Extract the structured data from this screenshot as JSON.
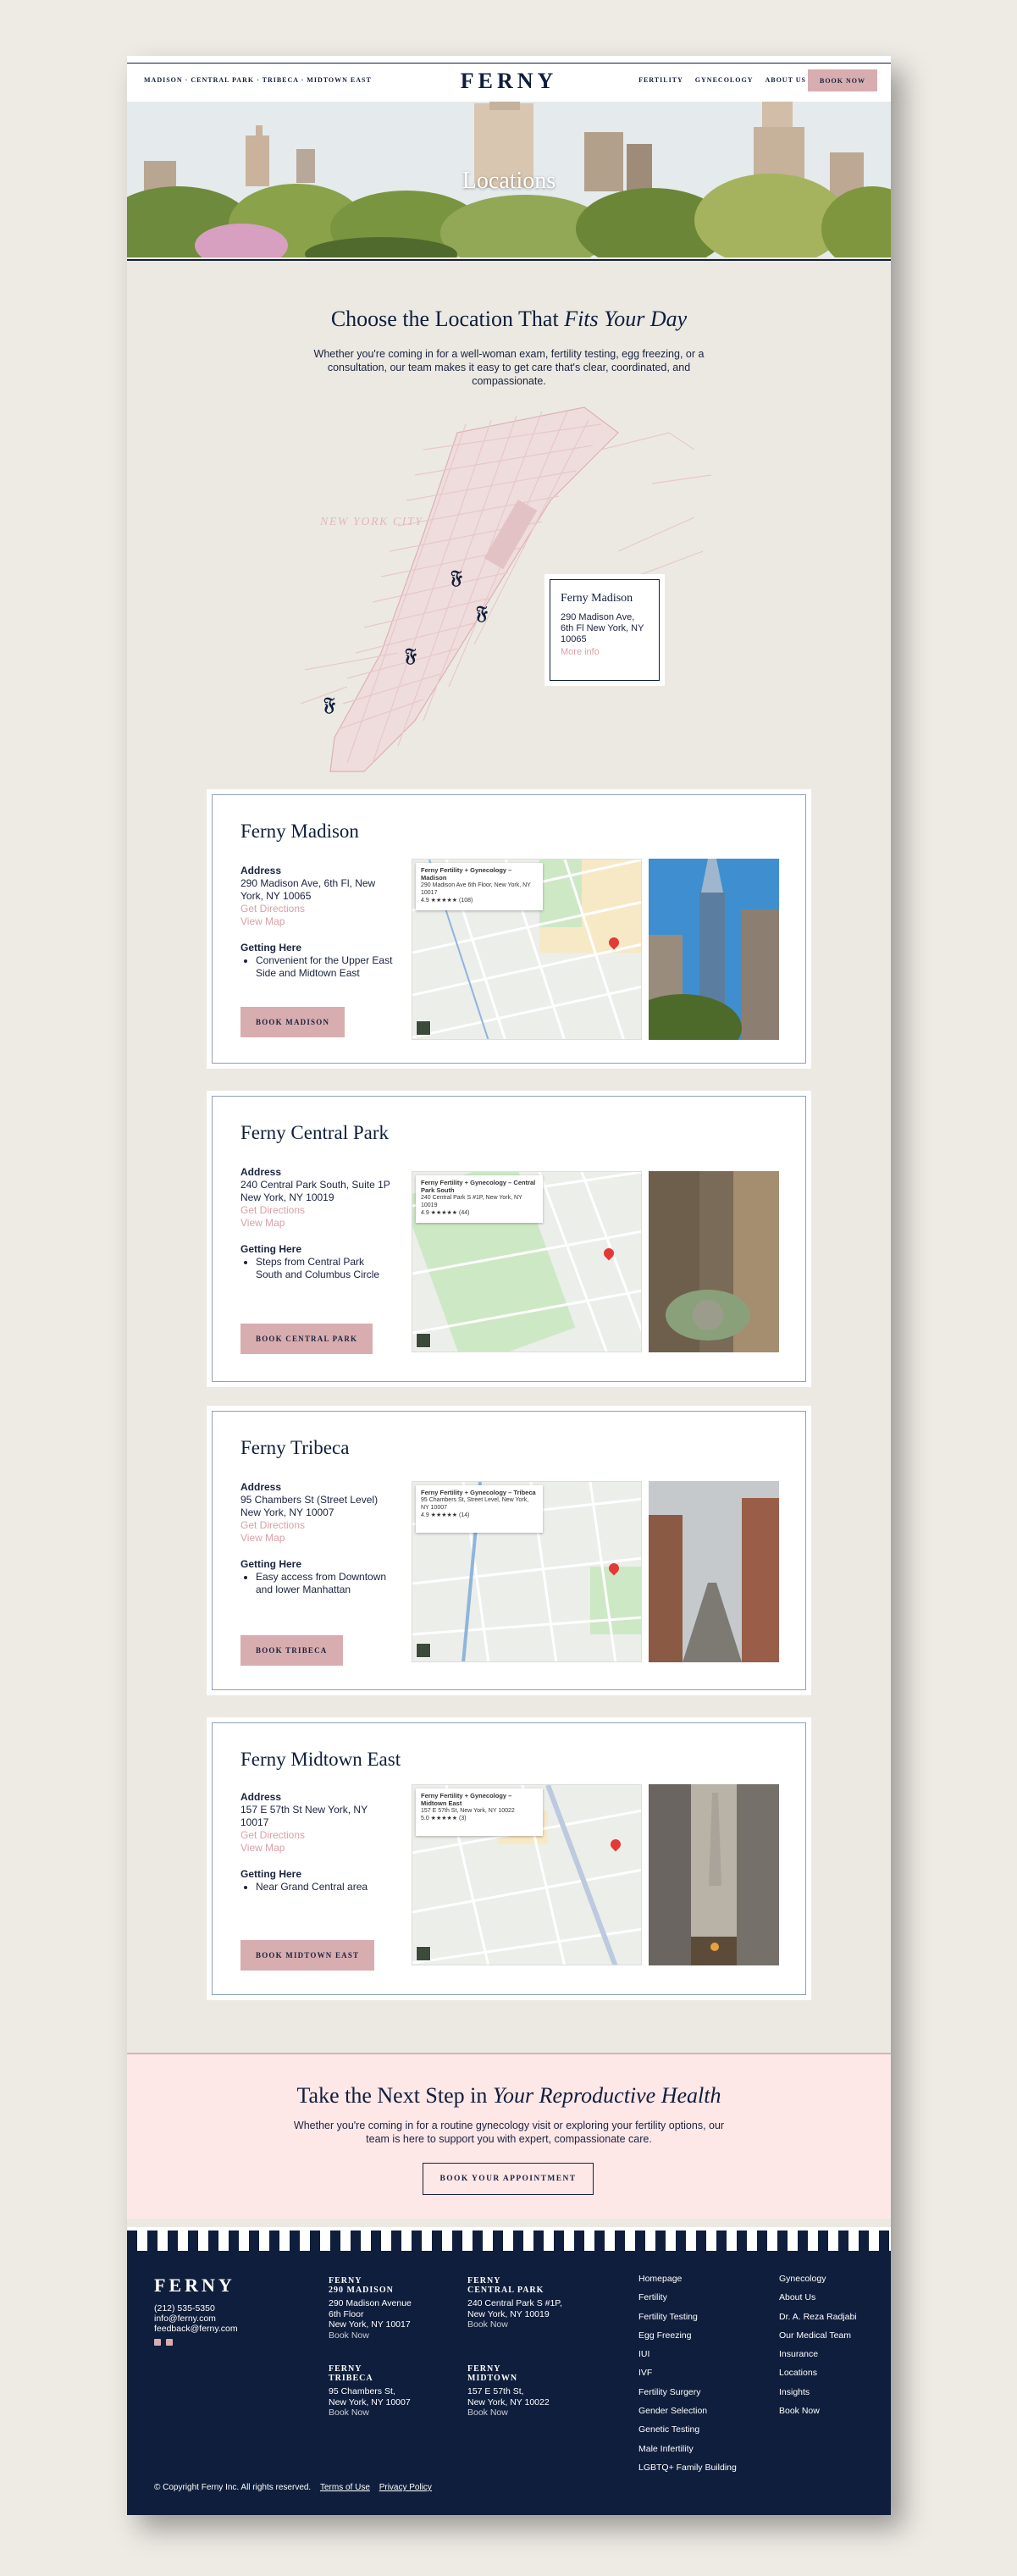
{
  "header": {
    "nav_left": "MADISON · CENTRAL PARK · TRIBECA · MIDTOWN EAST",
    "logo": "FERNY",
    "nav_right": [
      "FERTILITY",
      "GYNECOLOGY",
      "ABOUT US"
    ],
    "book_now": "BOOK NOW"
  },
  "hero": {
    "title": "Locations"
  },
  "intro": {
    "title_plain": "Choose the Location That ",
    "title_italic": "Fits Your Day",
    "text": "Whether you're coming in for a well-woman exam, fertility testing, egg freezing, or a consultation, our team makes it easy to get care that's clear, coordinated, and compassionate."
  },
  "map": {
    "city_label": "NEW YORK CITY",
    "card": {
      "name": "Ferny Madison",
      "address": "290 Madison Ave, 6th Fl New York, NY 10065",
      "more": "More info"
    }
  },
  "locations": [
    {
      "name": "Ferny Madison",
      "address_label": "Address",
      "address": "290 Madison Ave, 6th Fl, New York, NY 10065",
      "directions": "Get Directions",
      "view_map": "View Map",
      "getting_here_label": "Getting Here",
      "getting_here": "Convenient for the Upper East Side and Midtown East",
      "button": "BOOK MADISON",
      "map_popup_title": "Ferny Fertility + Gynecology – Madison",
      "map_popup_addr": "290 Madison Ave 6th Floor, New York, NY 10017",
      "map_popup_rating": "4.9 ★★★★★ (108)"
    },
    {
      "name": "Ferny Central Park",
      "address_label": "Address",
      "address": "240 Central Park South, Suite 1P New York, NY 10019",
      "directions": "Get Directions",
      "view_map": "View Map",
      "getting_here_label": "Getting Here",
      "getting_here": "Steps from Central Park South and Columbus Circle",
      "button": "BOOK CENTRAL PARK",
      "map_popup_title": "Ferny Fertility + Gynecology – Central Park South",
      "map_popup_addr": "240 Central Park S #1P, New York, NY 10019",
      "map_popup_rating": "4.9 ★★★★★ (44)"
    },
    {
      "name": "Ferny Tribeca",
      "address_label": "Address",
      "address": "95 Chambers St (Street Level) New York, NY 10007",
      "directions": "Get Directions",
      "view_map": "View Map",
      "getting_here_label": "Getting Here",
      "getting_here": "Easy access from Downtown and lower Manhattan",
      "button": "BOOK TRIBECA",
      "map_popup_title": "Ferny Fertility + Gynecology – Tribeca",
      "map_popup_addr": "95 Chambers St, Street Level, New York, NY 10007",
      "map_popup_rating": "4.9 ★★★★★ (14)"
    },
    {
      "name": "Ferny Midtown East",
      "address_label": "Address",
      "address": "157 E 57th St New York, NY 10017",
      "directions": "Get Directions",
      "view_map": "View Map",
      "getting_here_label": "Getting Here",
      "getting_here": "Near Grand Central area",
      "button": "BOOK MIDTOWN EAST",
      "map_popup_title": "Ferny Fertility + Gynecology – Midtown East",
      "map_popup_addr": "157 E 57th St, New York, NY 10022",
      "map_popup_rating": "5.0 ★★★★★ (3)"
    }
  ],
  "cta": {
    "title_plain": "Take the Next Step in ",
    "title_italic": "Your Reproductive Health",
    "text": "Whether you're coming in for a routine gynecology visit or exploring your fertility options, our team is here to support you with expert, compassionate care.",
    "button": "BOOK YOUR APPOINTMENT"
  },
  "footer": {
    "logo": "FERNY",
    "phone": "(212) 535-5350",
    "email1": "info@ferny.com",
    "email2": "feedback@ferny.com",
    "loc_madison": {
      "h1": "FERNY",
      "h2": "290 MADISON",
      "l1": "290 Madison Avenue",
      "l2": "6th Floor",
      "l3": "New York, NY 10017",
      "book": "Book Now"
    },
    "loc_central": {
      "h1": "FERNY",
      "h2": "CENTRAL PARK",
      "l1": "240 Central Park S #1P,",
      "l2": "New York, NY 10019",
      "book": "Book Now"
    },
    "loc_tribeca": {
      "h1": "FERNY",
      "h2": "TRIBECA",
      "l1": "95 Chambers St,",
      "l2": "New York, NY 10007",
      "book": "Book Now"
    },
    "loc_midtown": {
      "h1": "FERNY",
      "h2": "MIDTOWN",
      "l1": "157 E 57th St,",
      "l2": "New York, NY 10022",
      "book": "Book Now"
    },
    "links1": [
      "Homepage",
      "Fertility",
      "Fertility Testing",
      "Egg Freezing",
      "IUI",
      "IVF",
      "Fertility Surgery",
      "Gender Selection",
      "Genetic Testing",
      "Male Infertility",
      "LGBTQ+ Family Building"
    ],
    "links2": [
      "Gynecology",
      "About Us",
      "Dr. A. Reza Radjabi",
      "Our Medical Team",
      "Insurance",
      "Locations",
      "Insights",
      "Book Now"
    ],
    "copyright": "© Copyright Ferny Inc. All rights reserved.",
    "terms": "Terms of Use",
    "privacy": "Privacy Policy"
  }
}
